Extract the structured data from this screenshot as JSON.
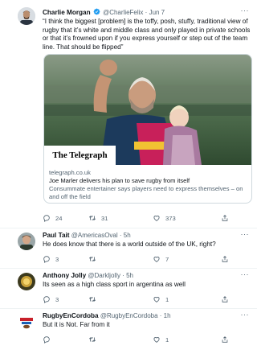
{
  "main_tweet": {
    "name": "Charlie Morgan",
    "handle": "@CharlieFelix",
    "date": "Jun 7",
    "text": "“I think the biggest [problem] is the toffy, posh, stuffy, traditional view of rugby that it’s white and middle class and only played in private schools or that it’s frowned upon if you express yourself or step out of the team line. That should be flipped”",
    "card": {
      "logo": "The Telegraph",
      "domain": "telegraph.co.uk",
      "title": "Joe Marler delivers his plan to save rugby from itself",
      "description": "Consummate entertainer says players need to express themselves – on and off the field"
    },
    "replies": "24",
    "retweets": "31",
    "likes": "373"
  },
  "replies": [
    {
      "name": "Paul Tait",
      "handle": "@AmericasOval",
      "time": "5h",
      "text": "He does know that there is a world outside of the UK, right?",
      "replies": "3",
      "retweets": "",
      "likes": "7"
    },
    {
      "name": "Anthony Jolly",
      "handle": "@Darkljolly",
      "time": "5h",
      "text": "Its seen as a high class sport in argentina as well",
      "replies": "3",
      "retweets": "",
      "likes": "1"
    },
    {
      "name": "RugbyEnCordoba",
      "handle": "@RugbyEnCordoba",
      "time": "1h",
      "text": "But it is Not. Far from it",
      "replies": "",
      "retweets": "",
      "likes": "1"
    }
  ],
  "icons": {
    "reply": "reply-icon",
    "retweet": "retweet-icon",
    "like": "heart-icon",
    "share": "share-icon",
    "more": "more-icon",
    "verified": "verified-badge-icon"
  },
  "colors": {
    "verified": "#1d9bf0",
    "secondary_text": "#536471",
    "border": "#cfd9de"
  }
}
